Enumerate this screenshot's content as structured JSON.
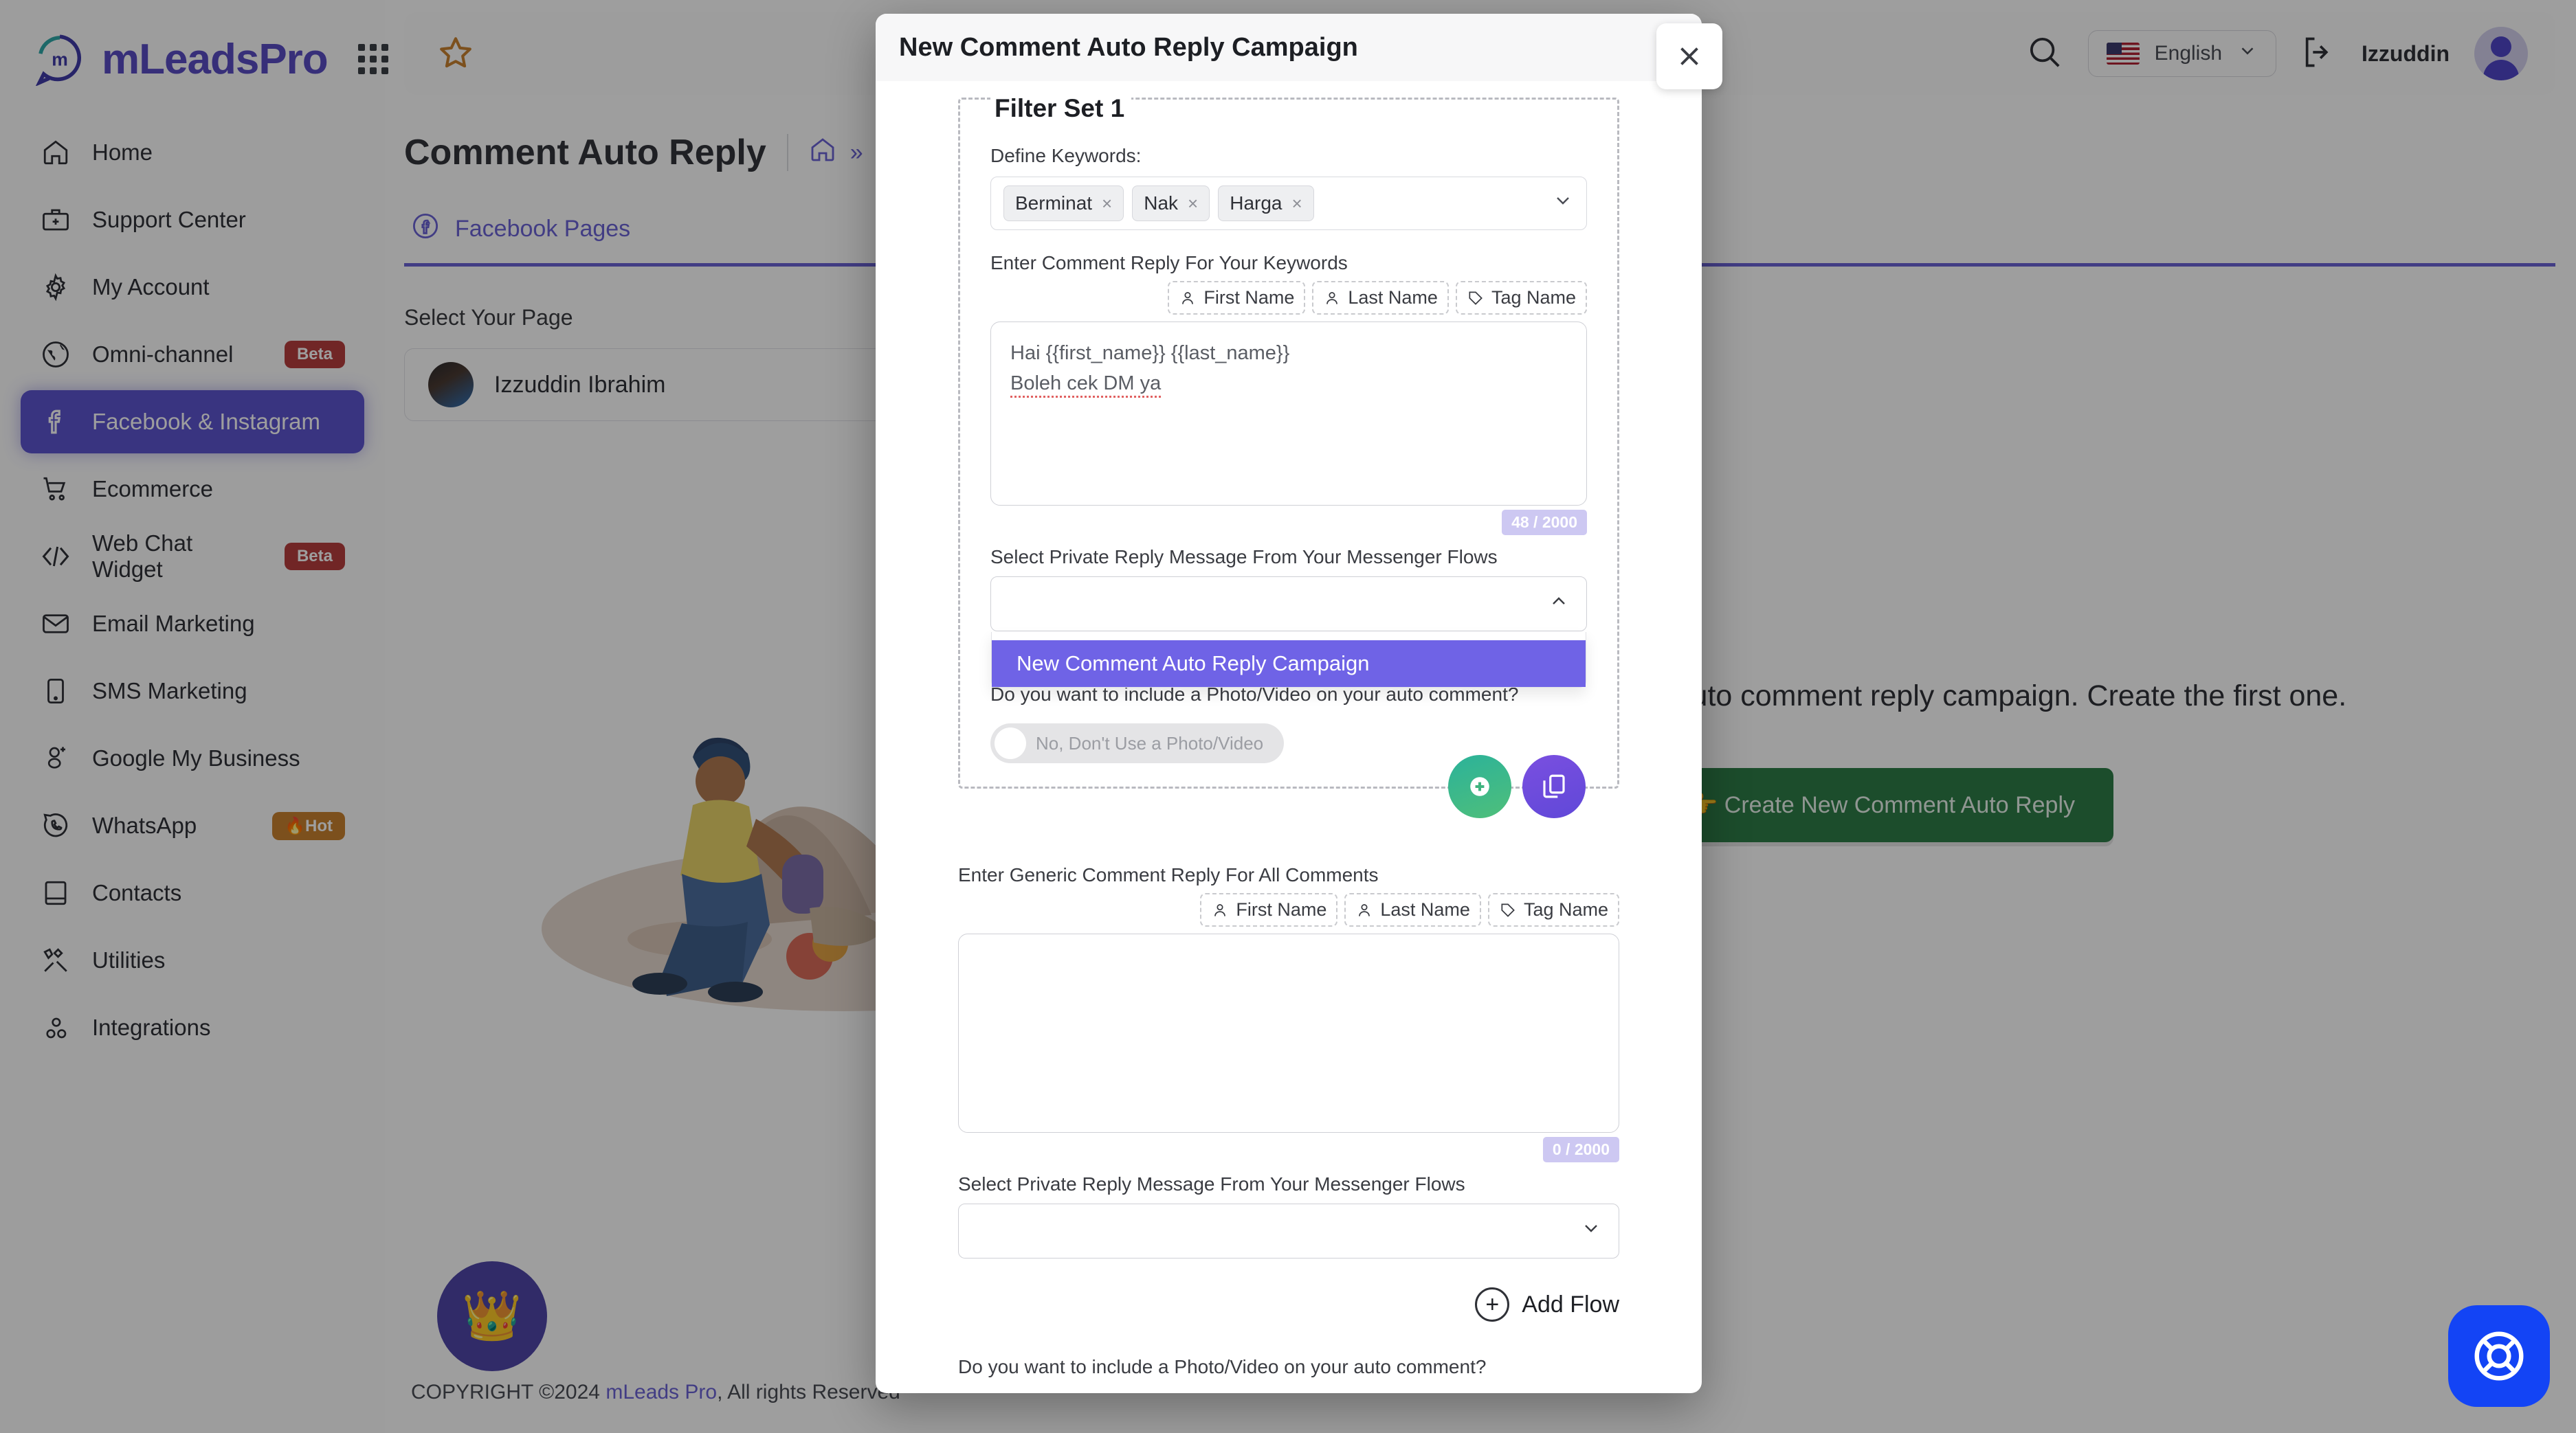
{
  "brand": {
    "name": "mLeadsPro",
    "apps_icon": "grid-apps-icon"
  },
  "sidebar": {
    "items": [
      {
        "label": "Home",
        "icon": "home-icon",
        "badge": null,
        "active": false
      },
      {
        "label": "Support Center",
        "icon": "briefcase-medical-icon",
        "badge": null,
        "active": false
      },
      {
        "label": "My Account",
        "icon": "gear-icon",
        "badge": null,
        "active": false
      },
      {
        "label": "Omni-channel",
        "icon": "globe-icon",
        "badge": "Beta",
        "badge_type": "beta",
        "active": false
      },
      {
        "label": "Facebook & Instagram",
        "icon": "facebook-icon",
        "badge": null,
        "active": true
      },
      {
        "label": "Ecommerce",
        "icon": "shopping-cart-icon",
        "badge": null,
        "active": false
      },
      {
        "label": "Web Chat Widget",
        "icon": "code-icon",
        "badge": "Beta",
        "badge_type": "beta",
        "active": false
      },
      {
        "label": "Email Marketing",
        "icon": "envelope-icon",
        "badge": null,
        "active": false
      },
      {
        "label": "SMS Marketing",
        "icon": "mobile-icon",
        "badge": null,
        "active": false
      },
      {
        "label": "Google My Business",
        "icon": "google-icon",
        "badge": null,
        "active": false
      },
      {
        "label": "WhatsApp",
        "icon": "whatsapp-icon",
        "badge": "Hot",
        "badge_type": "hot",
        "active": false
      },
      {
        "label": "Contacts",
        "icon": "book-icon",
        "badge": null,
        "active": false
      },
      {
        "label": "Utilities",
        "icon": "tools-icon",
        "badge": null,
        "active": false
      },
      {
        "label": "Integrations",
        "icon": "gears-icon",
        "badge": null,
        "active": false
      }
    ]
  },
  "topbar": {
    "star_icon": "star-icon",
    "search_icon": "search-icon",
    "language": "English",
    "language_caret": "chevron-down-icon",
    "logout_icon": "logout-icon",
    "user_name": "Izzuddin",
    "avatar": "user-avatar"
  },
  "page": {
    "title": "Comment Auto Reply",
    "home_icon": "home-breadcrumb-icon",
    "breadcrumb_sep": "»",
    "tab_label": "Facebook Pages",
    "tab_icon": "facebook-circle-icon",
    "select_page_label": "Select Your Page",
    "selected_page": "Izzuddin Ibrahim",
    "empty_message": "You don't have any auto comment reply campaign. Create the first one.",
    "create_button": "👉 Create New Comment Auto Reply",
    "footer_prefix": "COPYRIGHT ©2024 ",
    "footer_link": "mLeads Pro",
    "footer_suffix": ", All rights Reserved",
    "crown_icon": "👑",
    "help_icon": "lifebuoy-icon"
  },
  "modal": {
    "title": "New Comment Auto Reply Campaign",
    "close_icon": "close-icon",
    "filter_set_title": "Filter Set 1",
    "keywords_label": "Define Keywords:",
    "keywords": [
      "Berminat",
      "Nak",
      "Harga"
    ],
    "keyword_remove_icon": "×",
    "keywords_caret": "chevron-down-icon",
    "keyword_reply_label": "Enter Comment Reply For Your Keywords",
    "tokens": [
      {
        "label": "First Name",
        "icon": "person-icon"
      },
      {
        "label": "Last Name",
        "icon": "person-icon"
      },
      {
        "label": "Tag Name",
        "icon": "tag-icon"
      }
    ],
    "keyword_reply_line1": "Hai {{first_name}} {{last_name}}",
    "keyword_reply_line2": "Boleh cek DM ya",
    "keyword_reply_counter": "48 / 2000",
    "private_reply_label": "Select Private Reply Message From Your Messenger Flows",
    "private_reply_value": "",
    "private_reply_caret": "chevron-up-icon",
    "dropdown_option": "New Comment Auto Reply Campaign",
    "photo_question": "Do you want to include a Photo/Video on your auto comment?",
    "photo_toggle_label": "No, Don't Use a Photo/Video",
    "add_filter_icon": "plus-circle-icon",
    "duplicate_filter_icon": "copy-icon",
    "generic_reply_label": "Enter Generic Comment Reply For All Comments",
    "generic_reply_value": "",
    "generic_reply_counter": "0 / 2000",
    "generic_private_reply_label": "Select Private Reply Message From Your Messenger Flows",
    "generic_private_reply_value": "",
    "generic_private_caret": "chevron-down-icon",
    "add_flow_label": "Add Flow",
    "add_flow_icon": "plus-circle-icon",
    "photo_question_bottom": "Do you want to include a Photo/Video on your auto comment?"
  },
  "colors": {
    "brand_purple": "#5a4cc4",
    "active_nav": "#5d55cf",
    "accent_dropdown": "#6f63e6",
    "green_button": "#2e7d47",
    "beta_badge": "#b73e3e",
    "hot_badge": "#c9822f",
    "help_blue": "#1344f5"
  }
}
